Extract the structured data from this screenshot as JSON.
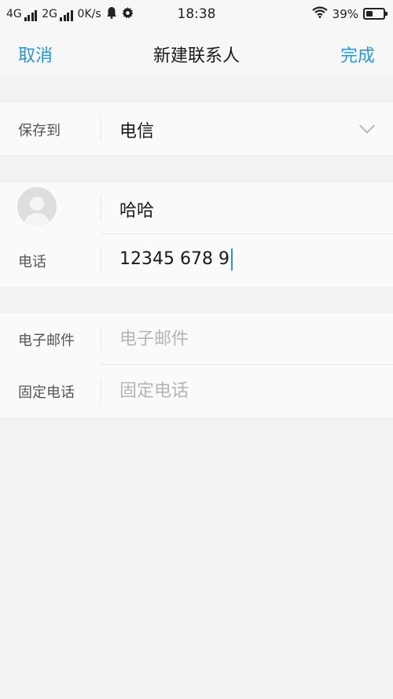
{
  "status_bar": {
    "network1": "4G",
    "network2": "2G",
    "speed": "0K/s",
    "time": "18:38",
    "battery_text": "39%",
    "battery_level": 0.39,
    "icons": [
      "signal-icon",
      "signal-icon",
      "notification-bell-icon",
      "settings-gear-icon",
      "wifi-icon",
      "battery-icon"
    ]
  },
  "nav": {
    "cancel": "取消",
    "title": "新建联系人",
    "done": "完成"
  },
  "save_to": {
    "label": "保存到",
    "value": "电信"
  },
  "contact": {
    "name": "哈哈",
    "phone_label": "电话",
    "phone_value": "12345 678 9"
  },
  "email": {
    "label": "电子邮件",
    "placeholder": "电子邮件"
  },
  "landline": {
    "label": "固定电话",
    "placeholder": "固定电话"
  },
  "colors": {
    "accent": "#2d97d4",
    "background": "#f2f2f2",
    "section": "#fafafa"
  }
}
